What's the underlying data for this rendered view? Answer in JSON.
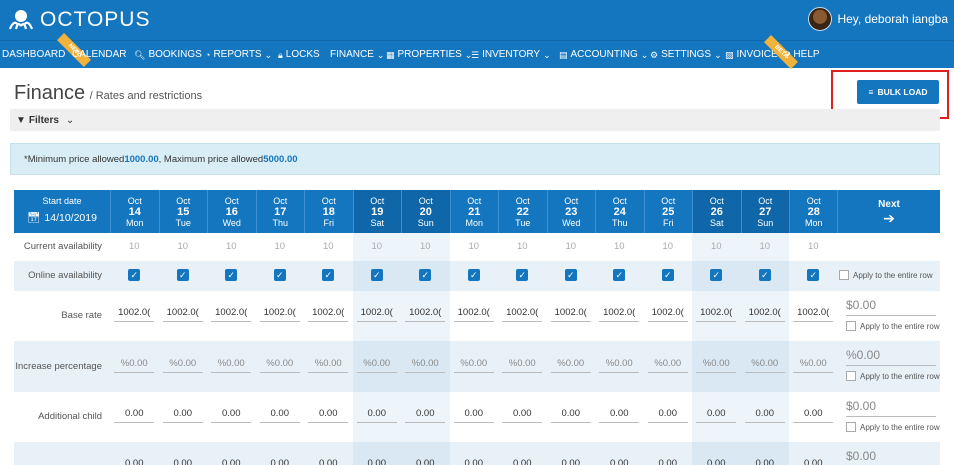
{
  "header": {
    "logo_text": "OCTOPUS",
    "user_greeting": "Hey, deborah iangba",
    "brand_color": "#1476bf"
  },
  "nav": {
    "items": [
      {
        "label": "DASHBOARD",
        "icon": ""
      },
      {
        "label": "CALENDAR",
        "icon": ""
      },
      {
        "label": "BOOKINGS",
        "icon": "search-icon"
      },
      {
        "label": "REPORTS",
        "icon": "chart-pie-icon"
      },
      {
        "label": "LOCKS",
        "icon": "lock-icon"
      },
      {
        "label": "FINANCE",
        "icon": ""
      },
      {
        "label": "PROPERTIES",
        "icon": "map-icon"
      },
      {
        "label": "INVENTORY",
        "icon": "list-icon"
      },
      {
        "label": "ACCOUNTING",
        "icon": "calculator-icon"
      },
      {
        "label": "SETTINGS",
        "icon": "gear-icon"
      },
      {
        "label": "INVOICE",
        "icon": "file-icon"
      },
      {
        "label": "HELP",
        "icon": "question-icon"
      }
    ],
    "ribbon_new": "NEW",
    "ribbon_beta": "BETA"
  },
  "page": {
    "title": "Finance",
    "subtitle": "/ Rates and restrictions",
    "bulk_load_label": "BULK LOAD",
    "filters_label": "Filters",
    "notice_prefix": "*Minimum price allowed ",
    "min_price": "1000.00",
    "notice_mid": " , Maximum price allowed ",
    "max_price": "5000.00"
  },
  "grid": {
    "start_label": "Start date",
    "start_date": "14/10/2019",
    "next_label": "Next",
    "days": [
      {
        "month": "Oct",
        "day": "14",
        "dow": "Mon",
        "weekend": false
      },
      {
        "month": "Oct",
        "day": "15",
        "dow": "Tue",
        "weekend": false
      },
      {
        "month": "Oct",
        "day": "16",
        "dow": "Wed",
        "weekend": false
      },
      {
        "month": "Oct",
        "day": "17",
        "dow": "Thu",
        "weekend": false
      },
      {
        "month": "Oct",
        "day": "18",
        "dow": "Fri",
        "weekend": false
      },
      {
        "month": "Oct",
        "day": "19",
        "dow": "Sat",
        "weekend": true
      },
      {
        "month": "Oct",
        "day": "20",
        "dow": "Sun",
        "weekend": true
      },
      {
        "month": "Oct",
        "day": "21",
        "dow": "Mon",
        "weekend": false
      },
      {
        "month": "Oct",
        "day": "22",
        "dow": "Tue",
        "weekend": false
      },
      {
        "month": "Oct",
        "day": "23",
        "dow": "Wed",
        "weekend": false
      },
      {
        "month": "Oct",
        "day": "24",
        "dow": "Thu",
        "weekend": false
      },
      {
        "month": "Oct",
        "day": "25",
        "dow": "Fri",
        "weekend": false
      },
      {
        "month": "Oct",
        "day": "26",
        "dow": "Sat",
        "weekend": true
      },
      {
        "month": "Oct",
        "day": "27",
        "dow": "Sun",
        "weekend": true
      },
      {
        "month": "Oct",
        "day": "28",
        "dow": "Mon",
        "weekend": false
      }
    ],
    "rows": {
      "current_availability": {
        "label": "Current availability",
        "value": "10"
      },
      "online_availability": {
        "label": "Online availability",
        "apply_label": "Apply to the entire row"
      },
      "base_rate": {
        "label": "Base rate",
        "values": [
          "1002.0(",
          "1002.0(",
          "1002.0(",
          "1002.0(",
          "1002.0(",
          "1002.0(",
          "1002.0(",
          "1002.0(",
          "1002.0(",
          "1002.0(",
          "1002.0(",
          "1002.0(",
          "1002.0(",
          "1002.0(",
          "1002.0("
        ],
        "row_value": "$0.00",
        "apply_label": "Apply to the entire row"
      },
      "increase_percentage": {
        "label": "Increase percentage",
        "value": "%0.00",
        "row_value": "%0.00",
        "apply_label": "Apply to the entire row"
      },
      "additional_child": {
        "label": "Additional child",
        "value": "0.00",
        "row_value": "$0.00",
        "apply_label": "Apply to the entire row"
      },
      "next_row": {
        "value": "0.00",
        "row_value": "$0.00"
      }
    }
  }
}
